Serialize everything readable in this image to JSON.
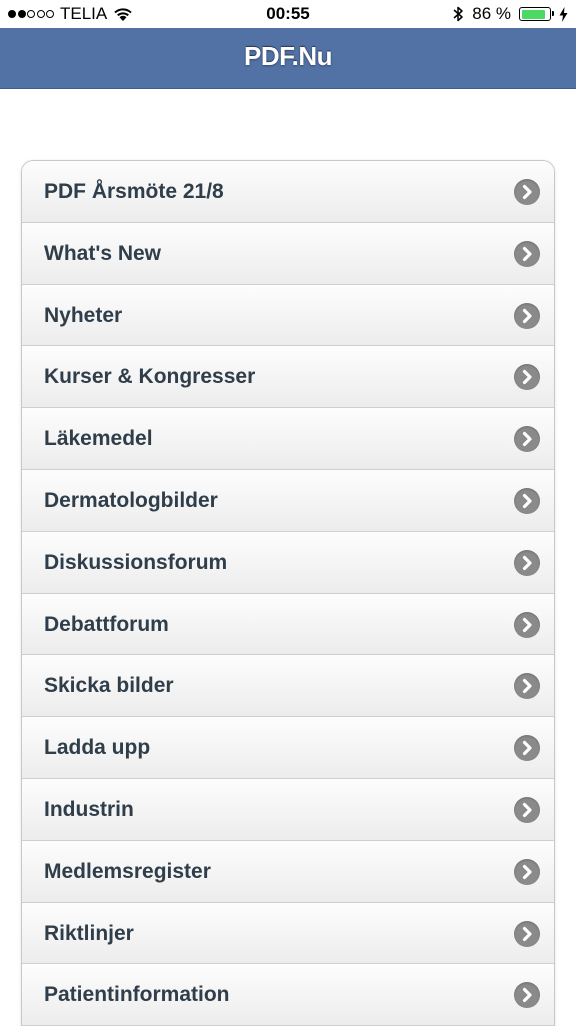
{
  "status_bar": {
    "carrier": "TELIA",
    "time": "00:55",
    "battery_percent": "86 %",
    "battery_level": 0.86,
    "signal_bars_filled": 2,
    "signal_bars_total": 5
  },
  "nav": {
    "title": "PDF.Nu"
  },
  "menu": {
    "items": [
      {
        "label": "PDF Årsmöte 21/8"
      },
      {
        "label": "What's New"
      },
      {
        "label": "Nyheter"
      },
      {
        "label": "Kurser & Kongresser"
      },
      {
        "label": "Läkemedel"
      },
      {
        "label": "Dermatologbilder"
      },
      {
        "label": "Diskussionsforum"
      },
      {
        "label": "Debattforum"
      },
      {
        "label": "Skicka bilder"
      },
      {
        "label": "Ladda upp"
      },
      {
        "label": "Industrin"
      },
      {
        "label": "Medlemsregister"
      },
      {
        "label": "Riktlinjer"
      },
      {
        "label": "Patientinformation"
      }
    ]
  },
  "colors": {
    "nav_background": "#5272a6",
    "battery_fill": "#4cd964",
    "chevron_circle": "#8a8a8a",
    "label_text": "#2f3e4a"
  },
  "icons": {
    "wifi": "wifi-icon",
    "bluetooth": "bluetooth-icon",
    "charging": "charging-bolt-icon",
    "disclosure": "chevron-right-icon"
  }
}
